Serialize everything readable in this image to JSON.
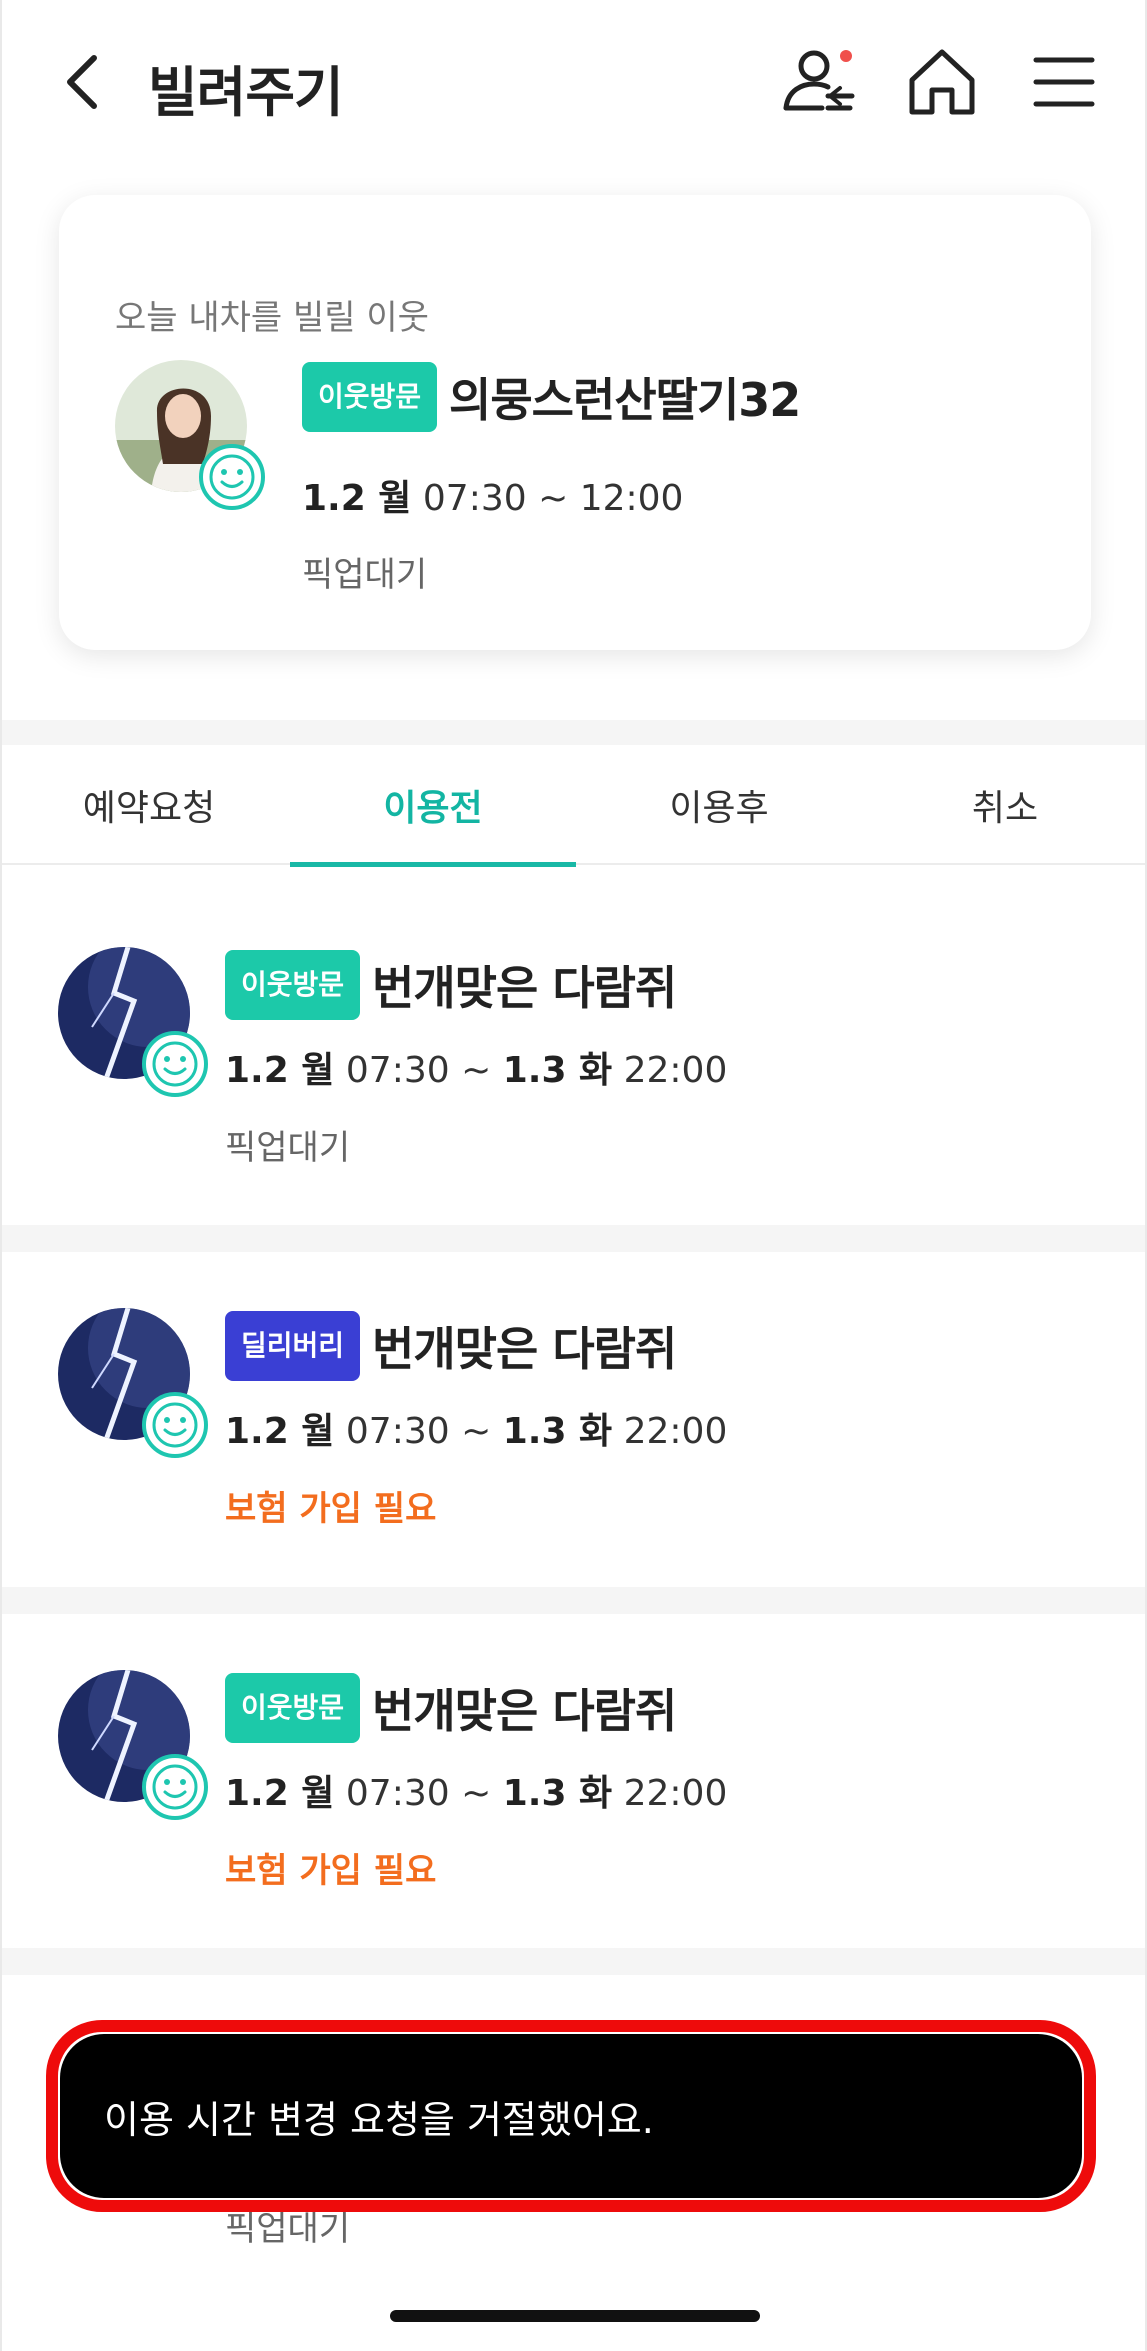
{
  "header": {
    "title": "빌려주기",
    "icons": [
      "back-icon",
      "user-notification-icon",
      "home-icon",
      "menu-icon"
    ],
    "notification_dot_color": "#f0504c"
  },
  "top_card": {
    "caption": "오늘 내차를 빌릴 이웃",
    "tag": "이웃방문",
    "nickname": "의뭉스런산딸기32",
    "date_bold": "1.2 월",
    "time": "07:30 ~ 12:00",
    "status": "픽업대기"
  },
  "tabs": [
    {
      "label": "예약요청",
      "active": false
    },
    {
      "label": "이용전",
      "active": true
    },
    {
      "label": "이용후",
      "active": false
    },
    {
      "label": "취소",
      "active": false
    }
  ],
  "items": [
    {
      "tag": "이웃방문",
      "tag_color": "#1cc9a9",
      "nickname": "번개맞은 다람쥐",
      "start_bold": "1.2 월",
      "start_time": "07:30",
      "sep": "~",
      "end_bold": "1.3 화",
      "end_time": "22:00",
      "status": "픽업대기",
      "status_warn": false
    },
    {
      "tag": "딜리버리",
      "tag_color": "#3a3fd4",
      "nickname": "번개맞은 다람쥐",
      "start_bold": "1.2 월",
      "start_time": "07:30",
      "sep": "~",
      "end_bold": "1.3 화",
      "end_time": "22:00",
      "status": "보험 가입 필요",
      "status_warn": true
    },
    {
      "tag": "이웃방문",
      "tag_color": "#1cc9a9",
      "nickname": "번개맞은 다람쥐",
      "start_bold": "1.2 월",
      "start_time": "07:30",
      "sep": "~",
      "end_bold": "1.3 화",
      "end_time": "22:00",
      "status": "보험 가입 필요",
      "status_warn": true
    },
    {
      "status": "픽업대기"
    }
  ],
  "toast": {
    "message": "이용 시간 변경 요청을 거절했어요."
  },
  "colors": {
    "accent": "#19b8a6",
    "teal_tag": "#1cc9a9",
    "delivery_tag": "#3a3fd4",
    "warning": "#f36d1e",
    "toast_outline": "#ee0b0b"
  }
}
